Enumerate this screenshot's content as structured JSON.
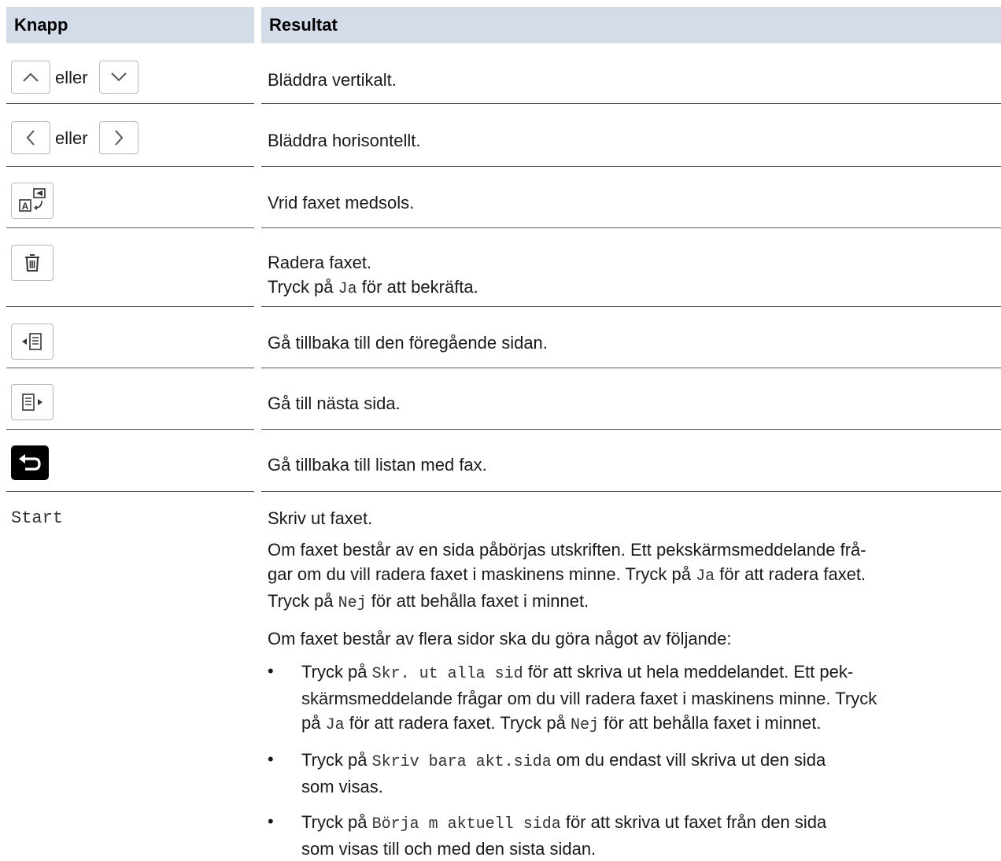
{
  "header": {
    "col_button": "Knapp",
    "col_result": "Resultat"
  },
  "rows": {
    "scroll_vertical": {
      "or": "eller",
      "result": "Bläddra vertikalt.",
      "icons": [
        "chevron-up-icon",
        "chevron-down-icon"
      ]
    },
    "scroll_horizontal": {
      "or": "eller",
      "result": "Bläddra horisontellt.",
      "icons": [
        "chevron-left-icon",
        "chevron-right-icon"
      ]
    },
    "rotate": {
      "result": "Vrid faxet medsols.",
      "icon": "rotate-page-icon"
    },
    "delete": {
      "result": "Radera faxet.",
      "confirm_prefix": "Tryck på",
      "confirm_code": "Ja",
      "confirm_suffix": "för att bekräfta.",
      "icon": "trash-icon"
    },
    "prev_page": {
      "result": "Gå tillbaka till den föregående sidan.",
      "icon": "previous-page-icon"
    },
    "next_page": {
      "result": "Gå till nästa sida.",
      "icon": "next-page-icon"
    },
    "back": {
      "result": "Gå tillbaka till listan med fax.",
      "icon": "back-arrow-icon"
    },
    "start": {
      "label": "Start",
      "result": "Skriv ut faxet.",
      "para1": {
        "l1": "Om faxet består av en sida påbörjas utskriften. Ett pekskärmsmeddelande frå-",
        "l2a": "gar om du vill radera faxet i maskinens minne. Tryck på",
        "l2code": "Ja",
        "l2b": "för att radera faxet.",
        "l3a": "Tryck på",
        "l3code": "Nej",
        "l3b": "för att behålla faxet i minnet."
      },
      "para2": "Om faxet består av flera sidor ska du göra något av följande:",
      "bullet_char": "•",
      "bullet1": {
        "l1a": "Tryck på",
        "l1code": "Skr. ut alla sid",
        "l1b": "för att skriva ut hela meddelandet. Ett pek-",
        "l2": "skärmsmeddelande frågar om du vill radera faxet i maskinens minne. Tryck",
        "l3a": "på",
        "l3code": "Ja",
        "l3b": "för att radera faxet. Tryck på",
        "l3code2": "Nej",
        "l3c": "för att behålla faxet i minnet."
      },
      "bullet2": {
        "l1a": "Tryck på",
        "l1code": "Skriv bara akt.sida",
        "l1b": "om du endast vill skriva ut den sida",
        "l2": "som visas."
      },
      "bullet3": {
        "l1a": "Tryck på",
        "l1code": "Börja m aktuell sida",
        "l1b": "för att skriva ut faxet från den sida",
        "l2": "som visas till och med den sista sidan."
      }
    }
  }
}
